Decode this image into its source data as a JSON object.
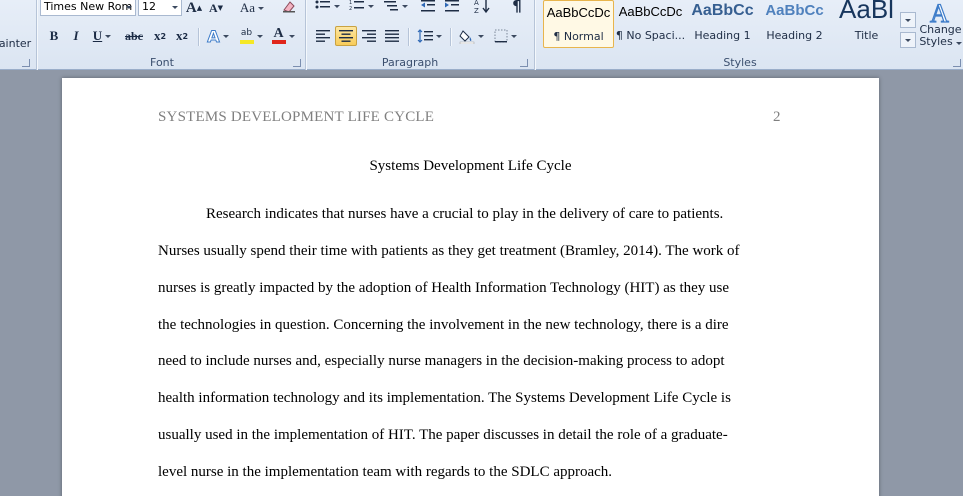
{
  "ribbon": {
    "clipboard": {
      "format_painter_label": "ainter"
    },
    "font": {
      "group_label": "Font",
      "font_name": "Times New Rom",
      "font_size": "12",
      "grow_font": "A",
      "shrink_font": "A",
      "change_case": "Aa",
      "bold": "B",
      "italic": "I",
      "underline": "U",
      "strikethrough": "abc",
      "subscript": "x",
      "superscript": "x",
      "text_effects": "A",
      "highlight": "ab",
      "font_color": "A"
    },
    "paragraph": {
      "group_label": "Paragraph",
      "pilcrow": "¶"
    },
    "styles": {
      "group_label": "Styles",
      "items": [
        {
          "sample": "AaBbCcDc",
          "name": "¶ Normal"
        },
        {
          "sample": "AaBbCcDc",
          "name": "¶ No Spaci..."
        },
        {
          "sample": "AaBbCc",
          "name": "Heading 1"
        },
        {
          "sample": "AaBbCc",
          "name": "Heading 2"
        },
        {
          "sample": "AaBl",
          "name": "Title"
        }
      ],
      "change_styles_line1": "Change",
      "change_styles_line2": "Styles"
    }
  },
  "document": {
    "header_title": "SYSTEMS DEVELOPMENT LIFE CYCLE",
    "page_number": "2",
    "title": "Systems Development Life Cycle",
    "lines": [
      "Research indicates that nurses have a crucial to play in the delivery of care to patients.",
      "Nurses usually spend their time with patients as they get treatment (Bramley, 2014). The work of",
      "nurses is greatly impacted by the adoption of Health Information Technology (HIT) as they use",
      "the technologies in question. Concerning the involvement in the new technology, there is a dire",
      "need to include nurses and, especially nurse managers in the decision-making process to adopt",
      "health information technology and its implementation.  The Systems Development Life Cycle is",
      "usually used in the implementation of HIT.  The paper discusses in detail the role of a graduate-",
      "level nurse in the implementation team with regards to the SDLC approach."
    ]
  },
  "colors": {
    "heading_blue": "#365f91",
    "heading_light_blue": "#4f81bd",
    "font_color_red": "#e0261b",
    "highlight_yellow": "#f5e826"
  }
}
